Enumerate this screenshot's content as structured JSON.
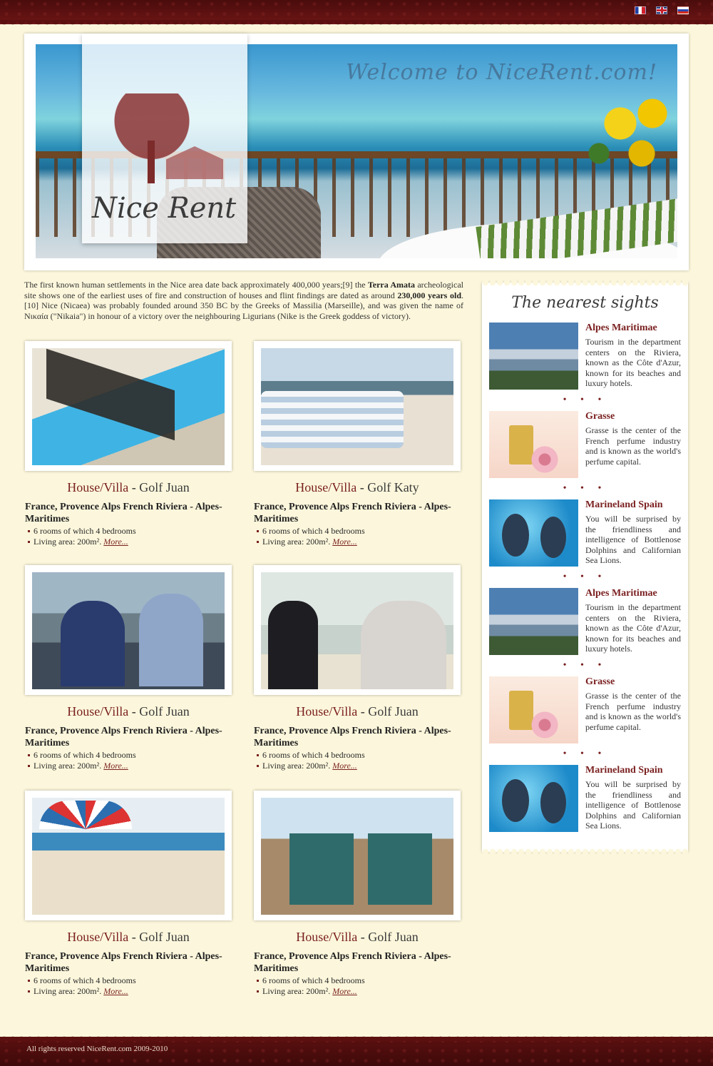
{
  "languages": [
    {
      "code": "fr",
      "icon": "flag-france-icon"
    },
    {
      "code": "en",
      "icon": "flag-uk-icon"
    },
    {
      "code": "ru",
      "icon": "flag-russia-icon"
    }
  ],
  "header": {
    "logo_text": "Nice Rent",
    "welcome": "Welcome to NiceRent.com!"
  },
  "intro": {
    "part1": "The first known human settlements in the Nice area date back approximately 400,000 years;[9] the ",
    "bold1": "Terra Amata",
    "part2": " archeological site shows one of the earliest uses of fire and construction of houses and flint findings are dated as around ",
    "bold2": "230,000 years old",
    "part3": ".[10] Nice (Nicaea) was probably founded around 350 BC by the Greeks of Massilia (Marseille), and was given the name of Νικαία (\"Nikaia\") in honour of a victory over the neighbouring Ligurians (Nike is the Greek goddess of victory)."
  },
  "listings": [
    {
      "type": "House/Villa",
      "name": "Golf Juan",
      "location": "France, Provence Alps French Riviera - Alpes-Maritimes",
      "rooms": "6 rooms of which 4 bedrooms",
      "area": "Living area: 200m².",
      "more": "More..."
    },
    {
      "type": "House/Villa",
      "name": "Golf Katy",
      "location": "France, Provence Alps French Riviera - Alpes-Maritimes",
      "rooms": "6 rooms of which 4 bedrooms",
      "area": "Living area: 200m².",
      "more": "More..."
    },
    {
      "type": "House/Villa",
      "name": "Golf Juan",
      "location": "France, Provence Alps French Riviera - Alpes-Maritimes",
      "rooms": "6 rooms of which 4 bedrooms",
      "area": "Living area: 200m².",
      "more": "More..."
    },
    {
      "type": "House/Villa",
      "name": "Golf Juan",
      "location": "France, Provence Alps French Riviera - Alpes-Maritimes",
      "rooms": "6 rooms of which 4 bedrooms",
      "area": "Living area: 200m².",
      "more": "More..."
    },
    {
      "type": "House/Villa",
      "name": "Golf Juan",
      "location": "France, Provence Alps French Riviera - Alpes-Maritimes",
      "rooms": "6 rooms of which 4 bedrooms",
      "area": "Living area: 200m².",
      "more": "More..."
    },
    {
      "type": "House/Villa",
      "name": "Golf Juan",
      "location": "France, Provence Alps French Riviera - Alpes-Maritimes",
      "rooms": "6 rooms of which 4 bedrooms",
      "area": "Living area: 200m².",
      "more": "More..."
    }
  ],
  "sidebar": {
    "title": "The nearest sights",
    "sights": [
      {
        "name": "Alpes Maritimae",
        "text": "Tourism in the department centers on the Riviera, known as the Côte d'Azur, known for its beaches and luxury hotels."
      },
      {
        "name": "Grasse",
        "text": "Grasse is the center of the French perfume industry and is known as the world's perfume capital."
      },
      {
        "name": "Marineland Spain",
        "text": "You will be surprised by the friendliness and intelligence of Bottlenose Dolphins and Californian Sea Lions."
      },
      {
        "name": "Alpes Maritimae",
        "text": "Tourism in the department centers on the Riviera, known as the Côte d'Azur, known for its beaches and luxury hotels."
      },
      {
        "name": "Grasse",
        "text": "Grasse is the center of the French perfume industry and is known as the world's perfume capital."
      },
      {
        "name": "Marineland Spain",
        "text": "You will be surprised by the friendliness and intelligence of Bottlenose Dolphins and Californian Sea Lions."
      }
    ],
    "separator": "• • •"
  },
  "footer": {
    "copyright": "All rights reserved NiceRent.com 2009-2010"
  },
  "colors": {
    "accent": "#7a1f1f",
    "background": "#fcf7dc",
    "band": "#5c1010"
  }
}
